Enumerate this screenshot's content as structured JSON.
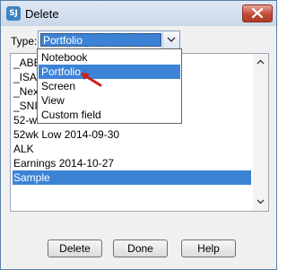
{
  "window": {
    "title": "Delete",
    "app_icon_text": "SJ"
  },
  "type_selector": {
    "label": "Type:",
    "value": "Portfolio"
  },
  "dropdown": {
    "options": [
      "Notebook",
      "Portfolio",
      "Screen",
      "View",
      "Custom field"
    ],
    "selected_index": 1
  },
  "list": {
    "items": [
      "_ABE",
      "_ISA",
      "_Nex",
      "_SNI",
      "52-we",
      "52wk Low 2014-09-30",
      "ALK",
      "Earnings 2014-10-27",
      "Sample"
    ],
    "selected_index": 8
  },
  "buttons": {
    "delete_label": "Delete",
    "done_label": "Done",
    "help_label": "Help"
  },
  "colors": {
    "selection": "#3c83d6",
    "close_button": "#c24a37",
    "pointer_arrow": "#c8201a"
  },
  "icons": {
    "app": "app-icon",
    "close": "close-icon",
    "dropdown": "chevron-down-icon",
    "scroll_up": "scroll-up-icon",
    "scroll_down": "scroll-down-icon",
    "pointer": "red-pointer-arrow-icon"
  }
}
